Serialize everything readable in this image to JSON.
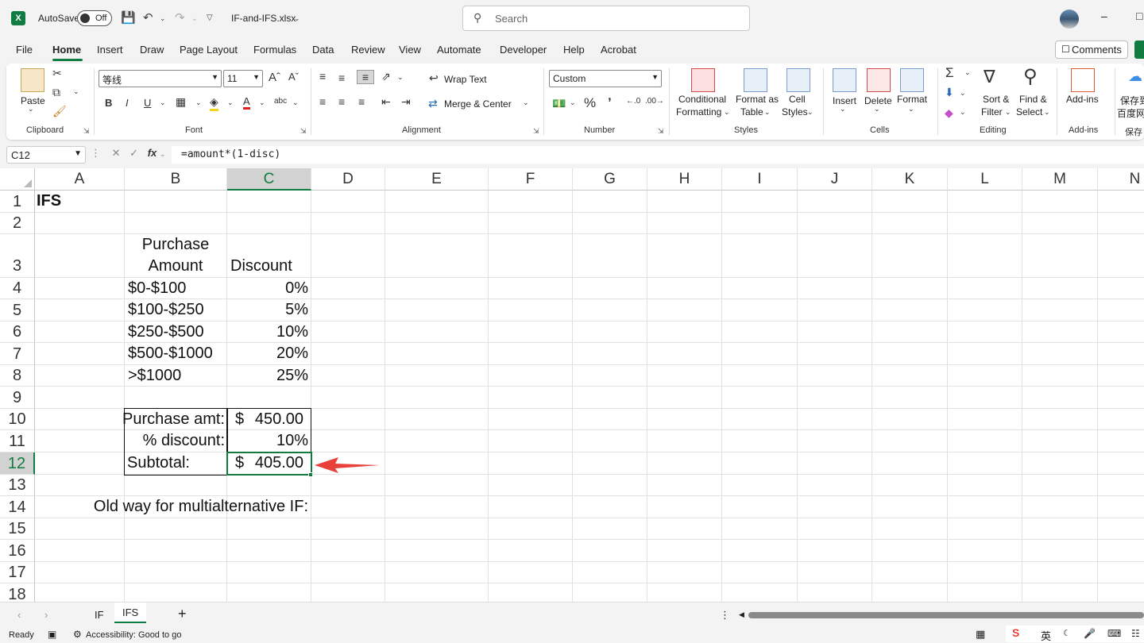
{
  "titlebar": {
    "autosave_label": "AutoSave",
    "autosave_state": "Off",
    "file_name": "IF-and-IFS.xlsx",
    "search_placeholder": "Search"
  },
  "tabs": [
    "File",
    "Home",
    "Insert",
    "Draw",
    "Page Layout",
    "Formulas",
    "Data",
    "Review",
    "View",
    "Automate",
    "Developer",
    "Help",
    "Acrobat"
  ],
  "active_tab": "Home",
  "comments_label": "Comments",
  "ribbon": {
    "clipboard": {
      "paste": "Paste",
      "label": "Clipboard"
    },
    "font": {
      "name": "等线",
      "size": "11",
      "label": "Font"
    },
    "alignment": {
      "wrap_text": "Wrap Text",
      "merge_center": "Merge & Center",
      "label": "Alignment"
    },
    "number": {
      "format": "Custom",
      "label": "Number"
    },
    "styles": {
      "conditional_1": "Conditional",
      "conditional_2": "Formatting",
      "format_table_1": "Format as",
      "format_table_2": "Table",
      "cell_styles_1": "Cell",
      "cell_styles_2": "Styles",
      "label": "Styles"
    },
    "cells": {
      "insert": "Insert",
      "delete": "Delete",
      "format": "Format",
      "label": "Cells"
    },
    "editing": {
      "sort_1": "Sort &",
      "sort_2": "Filter",
      "find_1": "Find &",
      "find_2": "Select",
      "label": "Editing"
    },
    "addins": {
      "addins": "Add-ins",
      "label": "Add-ins"
    },
    "save": {
      "line1": "保存到",
      "line2": "百度网",
      "label": "保存"
    }
  },
  "formula_bar": {
    "name_box": "C12",
    "formula": "=amount*(1-disc)"
  },
  "columns": [
    "A",
    "B",
    "C",
    "D",
    "E",
    "F",
    "G",
    "H",
    "I",
    "J",
    "K",
    "L",
    "M",
    "N"
  ],
  "rows": [
    "1",
    "2",
    "3",
    "4",
    "5",
    "6",
    "7",
    "8",
    "9",
    "10",
    "11",
    "12",
    "13",
    "14",
    "15",
    "16",
    "17",
    "18"
  ],
  "cells": {
    "A1": "IFS",
    "B3_line1": "Purchase",
    "B3_line2": "Amount",
    "C3": "Discount",
    "B4": "$0-$100",
    "C4": "0%",
    "B5": "$100-$250",
    "C5": "5%",
    "B6": "$250-$500",
    "C6": "10%",
    "B7": "$500-$1000",
    "C7": "20%",
    "B8": ">$1000",
    "C8": "25%",
    "B10": "Purchase amt:",
    "C10_sym": "$",
    "C10": "450.00",
    "B11": "% discount:",
    "C11": "10%",
    "B12": "Subtotal:",
    "C12_sym": "$",
    "C12": "405.00",
    "B14": "Old way for multialternative IF:"
  },
  "sheets": [
    "IF",
    "IFS"
  ],
  "active_sheet": "IFS",
  "status": {
    "ready": "Ready",
    "accessibility": "Accessibility: Good to go"
  },
  "ime": {
    "lang": "英"
  },
  "colors": {
    "accent": "#107c41",
    "arrow": "#e8403a"
  }
}
